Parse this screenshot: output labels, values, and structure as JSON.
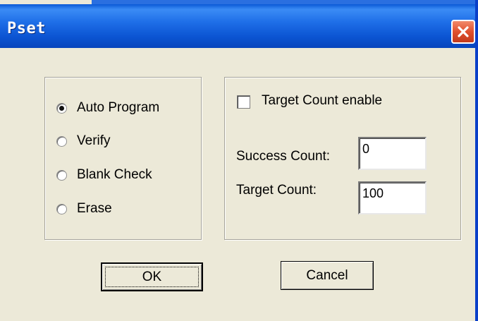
{
  "window": {
    "title": "Pset"
  },
  "modes": {
    "items": [
      {
        "label": "Auto Program",
        "checked": true
      },
      {
        "label": "Verify",
        "checked": false
      },
      {
        "label": "Blank Check",
        "checked": false
      },
      {
        "label": "Erase",
        "checked": false
      }
    ]
  },
  "counts": {
    "target_enable_label": "Target Count enable",
    "target_enable_checked": false,
    "success_label": "Success Count:",
    "success_value": "0",
    "target_label": "Target Count:",
    "target_value": "100"
  },
  "buttons": {
    "ok_label": "OK",
    "cancel_label": "Cancel"
  },
  "colors": {
    "titlebar": "#0b54d2",
    "close": "#e0502e",
    "dialog_bg": "#ece9d8"
  },
  "icons": {
    "close": "close-icon"
  }
}
